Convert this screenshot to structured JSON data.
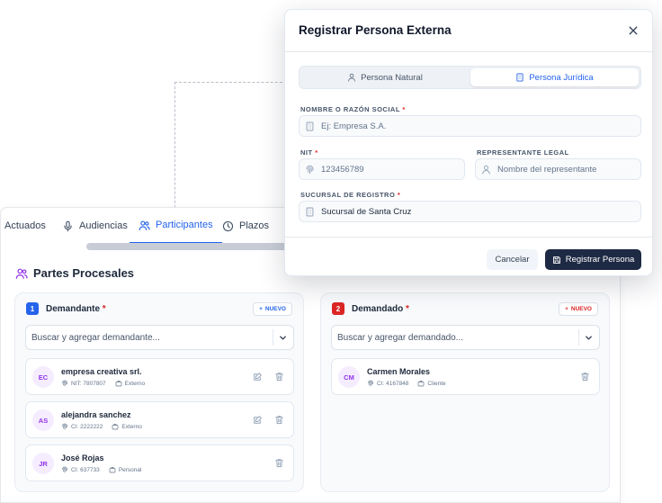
{
  "tabs": [
    {
      "label": "Actuados",
      "icon": "none"
    },
    {
      "label": "Audiencias",
      "icon": "microphone-icon"
    },
    {
      "label": "Participantes",
      "icon": "users-icon",
      "active": true
    },
    {
      "label": "Plazos",
      "icon": "clock-icon"
    }
  ],
  "section": {
    "title": "Partes Procesales",
    "icon": "users-icon"
  },
  "demandante": {
    "number": "1",
    "title": "Demandante",
    "required_mark": "*",
    "new_label": "NUEVO",
    "search_placeholder": "Buscar y agregar demandante...",
    "people": [
      {
        "initials": "EC",
        "name": "empresa creativa srl.",
        "id_text": "NIT: 7807807",
        "type": "Externo",
        "editable": true
      },
      {
        "initials": "AS",
        "name": "alejandra sanchez",
        "id_text": "CI: 2222222",
        "type": "Externo",
        "editable": true
      },
      {
        "initials": "JR",
        "name": "José Rojas",
        "id_text": "CI: 637733",
        "type": "Personal",
        "editable": false
      }
    ]
  },
  "demandado": {
    "number": "2",
    "title": "Demandado",
    "required_mark": "*",
    "new_label": "NUEVO",
    "search_placeholder": "Buscar y agregar demandado...",
    "people": [
      {
        "initials": "CM",
        "name": "Carmen Morales",
        "id_text": "CI: 4167848",
        "type": "Cliente",
        "editable": false
      }
    ]
  },
  "modal": {
    "title": "Registrar Persona Externa",
    "segments": [
      {
        "label": "Persona Natural",
        "icon": "user-icon",
        "active": false
      },
      {
        "label": "Persona Jurídica",
        "icon": "building-icon",
        "active": true
      }
    ],
    "fields": {
      "razon_social": {
        "label": "NOMBRE O RAZÓN SOCIAL",
        "required": "*",
        "placeholder": "Ej: Empresa S.A.",
        "value": ""
      },
      "nit": {
        "label": "NIT",
        "required": "*",
        "placeholder": "123456789",
        "value": ""
      },
      "representante": {
        "label": "REPRESENTANTE LEGAL",
        "placeholder": "Nombre del representante",
        "value": ""
      },
      "sucursal": {
        "label": "SUCURSAL DE REGISTRO",
        "required": "*",
        "value": "Sucursal de Santa Cruz"
      }
    },
    "cancel_label": "Cancelar",
    "save_label": "Registrar Persona"
  },
  "colors": {
    "accent": "#2563eb",
    "danger": "#dc2626",
    "primary_dark": "#1e2a44",
    "avatar_text": "#9333ea"
  }
}
